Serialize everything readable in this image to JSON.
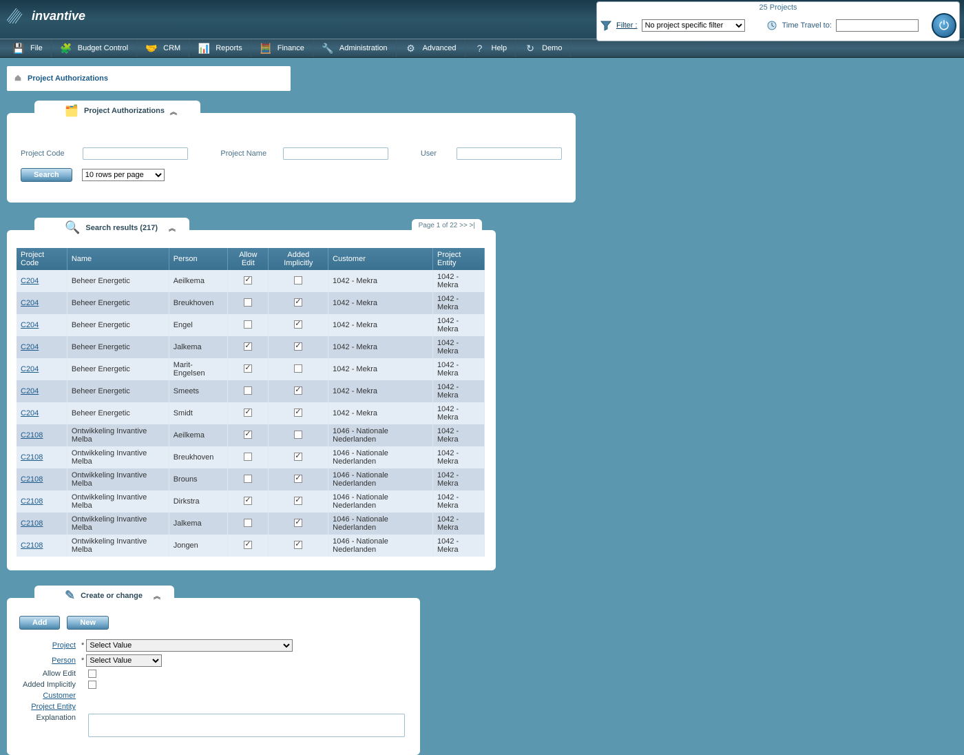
{
  "top": {
    "brand": "invantive",
    "project_count": "25 Projects",
    "filter_label": "Filter :",
    "filter_select": "No project specific filter",
    "time_travel_label": "Time Travel to:"
  },
  "menu": [
    {
      "icon": "💾",
      "label": "File"
    },
    {
      "icon": "🧩",
      "label": "Budget Control"
    },
    {
      "icon": "🤝",
      "label": "CRM"
    },
    {
      "icon": "📊",
      "label": "Reports"
    },
    {
      "icon": "🧮",
      "label": "Finance"
    },
    {
      "icon": "🔧",
      "label": "Administration"
    },
    {
      "icon": "⚙",
      "label": "Advanced"
    },
    {
      "icon": "?",
      "label": "Help"
    },
    {
      "icon": "↻",
      "label": "Demo"
    }
  ],
  "breadcrumb": "Project Authorizations",
  "search": {
    "tab": "Project Authorizations",
    "f1": "Project Code",
    "f2": "Project Name",
    "f3": "User",
    "search_btn": "Search",
    "rows_select": "10 rows per page"
  },
  "results": {
    "tab": "Search results (217)",
    "pager": "Page 1 of 22  >>  >|",
    "headers": [
      "Project Code",
      "Name",
      "Person",
      "Allow Edit",
      "Added Implicitly",
      "Customer",
      "Project Entity"
    ],
    "rows": [
      {
        "code": "C204",
        "name": "Beheer Energetic",
        "person": "Aeilkema",
        "allow": true,
        "impl": false,
        "cust": "1042 - Mekra",
        "ent": "1042 - Mekra"
      },
      {
        "code": "C204",
        "name": "Beheer Energetic",
        "person": "Breukhoven",
        "allow": false,
        "impl": true,
        "cust": "1042 - Mekra",
        "ent": "1042 - Mekra"
      },
      {
        "code": "C204",
        "name": "Beheer Energetic",
        "person": "Engel",
        "allow": false,
        "impl": true,
        "cust": "1042 - Mekra",
        "ent": "1042 - Mekra"
      },
      {
        "code": "C204",
        "name": "Beheer Energetic",
        "person": "Jalkema",
        "allow": true,
        "impl": true,
        "cust": "1042 - Mekra",
        "ent": "1042 - Mekra"
      },
      {
        "code": "C204",
        "name": "Beheer Energetic",
        "person": "Marit-Engelsen",
        "allow": true,
        "impl": false,
        "cust": "1042 - Mekra",
        "ent": "1042 - Mekra"
      },
      {
        "code": "C204",
        "name": "Beheer Energetic",
        "person": "Smeets",
        "allow": false,
        "impl": true,
        "cust": "1042 - Mekra",
        "ent": "1042 - Mekra"
      },
      {
        "code": "C204",
        "name": "Beheer Energetic",
        "person": "Smidt",
        "allow": true,
        "impl": true,
        "cust": "1042 - Mekra",
        "ent": "1042 - Mekra"
      },
      {
        "code": "C2108",
        "name": "Ontwikkeling Invantive Melba",
        "person": "Aeilkema",
        "allow": true,
        "impl": false,
        "cust": "1046 - Nationale Nederlanden",
        "ent": "1042 - Mekra"
      },
      {
        "code": "C2108",
        "name": "Ontwikkeling Invantive Melba",
        "person": "Breukhoven",
        "allow": false,
        "impl": true,
        "cust": "1046 - Nationale Nederlanden",
        "ent": "1042 - Mekra"
      },
      {
        "code": "C2108",
        "name": "Ontwikkeling Invantive Melba",
        "person": "Brouns",
        "allow": false,
        "impl": true,
        "cust": "1046 - Nationale Nederlanden",
        "ent": "1042 - Mekra"
      },
      {
        "code": "C2108",
        "name": "Ontwikkeling Invantive Melba",
        "person": "Dirkstra",
        "allow": true,
        "impl": true,
        "cust": "1046 - Nationale Nederlanden",
        "ent": "1042 - Mekra"
      },
      {
        "code": "C2108",
        "name": "Ontwikkeling Invantive Melba",
        "person": "Jalkema",
        "allow": false,
        "impl": true,
        "cust": "1046 - Nationale Nederlanden",
        "ent": "1042 - Mekra"
      },
      {
        "code": "C2108",
        "name": "Ontwikkeling Invantive Melba",
        "person": "Jongen",
        "allow": true,
        "impl": true,
        "cust": "1046 - Nationale Nederlanden",
        "ent": "1042 - Mekra"
      }
    ]
  },
  "form": {
    "tab": "Create or change",
    "add_btn": "Add",
    "new_btn": "New",
    "project_label": "Project",
    "person_label": "Person",
    "allow_label": "Allow Edit",
    "impl_label": "Added Implicitly",
    "customer_label": "Customer",
    "entity_label": "Project Entity",
    "expl_label": "Explanation",
    "select_value": "Select Value"
  }
}
